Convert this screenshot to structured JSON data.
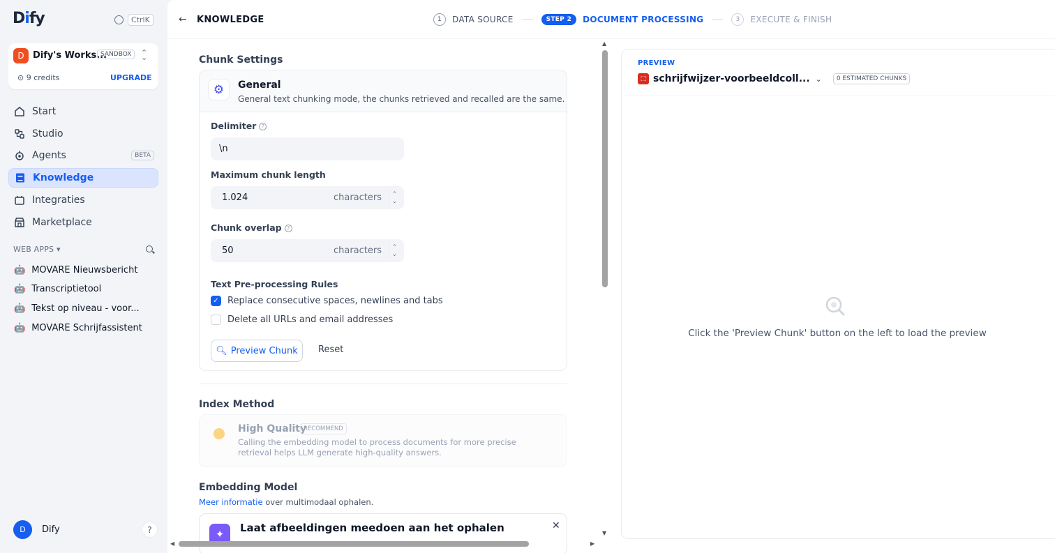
{
  "sidebar": {
    "logo": "Dify",
    "shortcut": "CtrlK",
    "workspace": {
      "avatar": "D",
      "name": "Dify's Works...",
      "plan": "SANDBOX",
      "credits": "9 credits",
      "upgrade": "UPGRADE"
    },
    "nav": [
      {
        "label": "Start",
        "icon": "home-icon"
      },
      {
        "label": "Studio",
        "icon": "studio-icon"
      },
      {
        "label": "Agents",
        "icon": "agents-icon",
        "badge": "BETA"
      },
      {
        "label": "Knowledge",
        "icon": "knowledge-icon",
        "active": true
      },
      {
        "label": "Integraties",
        "icon": "integrations-icon"
      },
      {
        "label": "Marketplace",
        "icon": "marketplace-icon"
      }
    ],
    "web_apps_label": "WEB APPS",
    "web_apps": [
      "MOVARE Nieuwsbericht",
      "Transcriptietool",
      "Tekst op niveau - voor...",
      "MOVARE Schrijfassistent"
    ],
    "user": {
      "avatar": "D",
      "name": "Dify"
    },
    "help": "?"
  },
  "header": {
    "back_title": "KNOWLEDGE",
    "steps": [
      {
        "num": "1",
        "label": "DATA SOURCE"
      },
      {
        "num": "STEP 2",
        "label": "DOCUMENT PROCESSING"
      },
      {
        "num": "3",
        "label": "EXECUTE & FINISH"
      }
    ]
  },
  "chunk_settings": {
    "title": "Chunk Settings",
    "mode_title": "General",
    "mode_desc": "General text chunking mode, the chunks retrieved and recalled are the same.",
    "delimiter_label": "Delimiter",
    "delimiter_value": "\\n",
    "max_len_label": "Maximum chunk length",
    "max_len_value": "1.024",
    "overlap_label": "Chunk overlap",
    "overlap_value": "50",
    "unit": "characters",
    "rules_label": "Text Pre-processing Rules",
    "rule_1": "Replace consecutive spaces, newlines and tabs",
    "rule_2": "Delete all URLs and email addresses",
    "preview_btn": "Preview Chunk",
    "reset_btn": "Reset"
  },
  "index": {
    "title": "Index Method",
    "option_title": "High Quality",
    "option_badge": "RECOMMEND",
    "option_desc": "Calling the embedding model to process documents for more precise retrieval helps LLM generate high-quality answers."
  },
  "embedding": {
    "title": "Embedding Model",
    "link": "Meer informatie",
    "sub": " over multimodaal ophalen.",
    "card_title": "Laat afbeeldingen meedoen aan het ophalen"
  },
  "preview": {
    "label": "PREVIEW",
    "file": "schrijfwijzer-voorbeeldcoll...",
    "chunks": "0 ESTIMATED CHUNKS",
    "empty": "Click the 'Preview Chunk' button on the left to load the preview"
  }
}
